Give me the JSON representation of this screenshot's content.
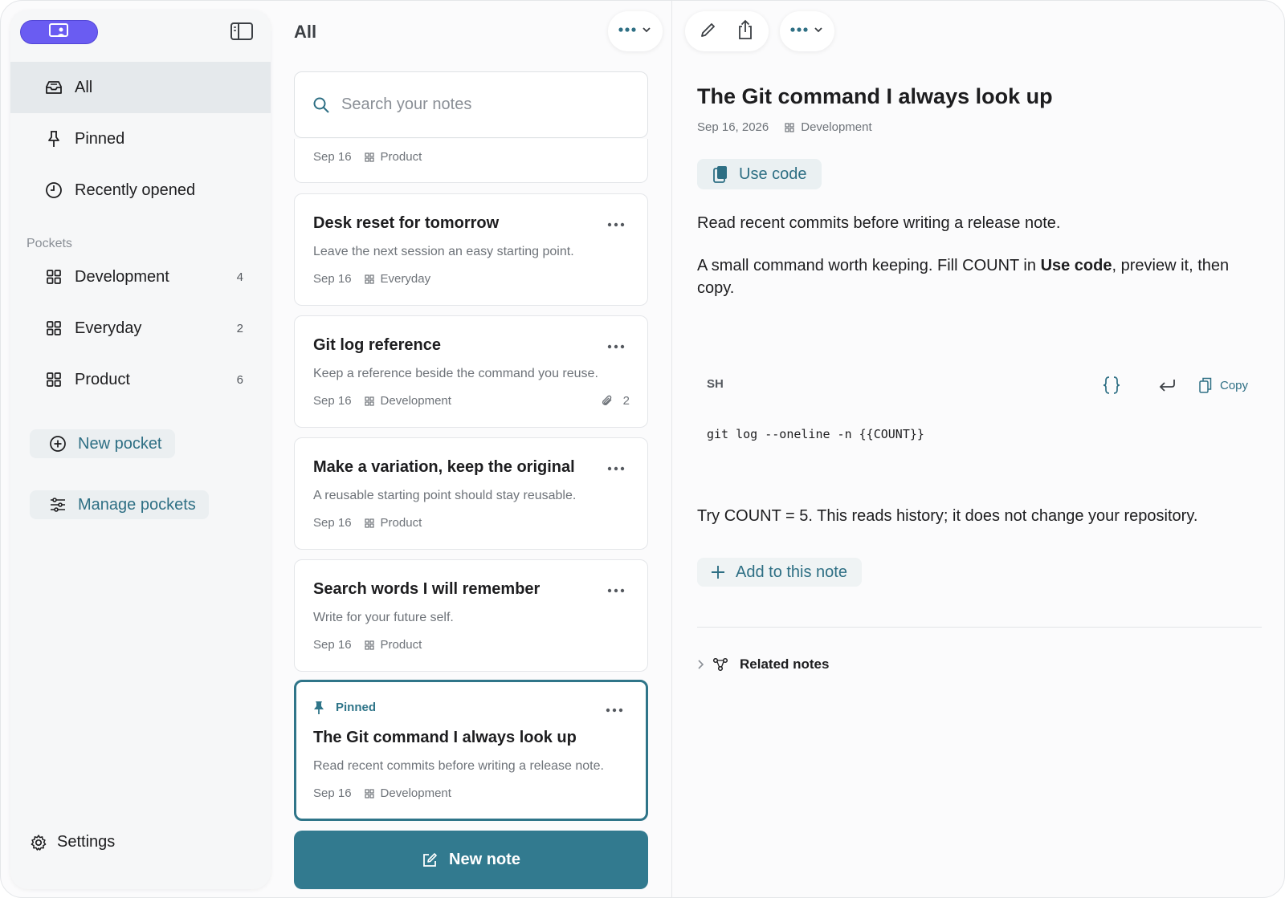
{
  "list": {
    "title": "All",
    "search_placeholder": "Search your notes",
    "partial_card": {
      "date": "Sep 16",
      "pocket": "Product"
    },
    "cards": [
      {
        "title": "Desk reset for tomorrow",
        "desc": "Leave the next session an easy starting point.",
        "date": "Sep 16",
        "pocket": "Everyday"
      },
      {
        "title": "Git log reference",
        "desc": "Keep a reference beside the command you reuse.",
        "date": "Sep 16",
        "pocket": "Development",
        "attachments": "2"
      },
      {
        "title": "Make a variation, keep the original",
        "desc": "A reusable starting point should stay reusable.",
        "date": "Sep 16",
        "pocket": "Product"
      },
      {
        "title": "Search words I will remember",
        "desc": "Write for your future self.",
        "date": "Sep 16",
        "pocket": "Product"
      },
      {
        "pinned_label": "Pinned",
        "title": "The Git command I always look up",
        "desc": "Read recent commits before writing a release note.",
        "date": "Sep 16",
        "pocket": "Development"
      }
    ],
    "new_note_label": "New note"
  },
  "sidebar": {
    "nav": [
      {
        "label": "All",
        "icon": "tray-icon"
      },
      {
        "label": "Pinned",
        "icon": "pin-icon"
      },
      {
        "label": "Recently opened",
        "icon": "clock-icon"
      }
    ],
    "pockets_label": "Pockets",
    "pockets": [
      {
        "label": "Development",
        "count": "4"
      },
      {
        "label": "Everyday",
        "count": "2"
      },
      {
        "label": "Product",
        "count": "6"
      }
    ],
    "new_pocket_label": "New pocket",
    "manage_pockets_label": "Manage pockets",
    "settings_label": "Settings"
  },
  "detail": {
    "title": "The Git command I always look up",
    "date": "Sep 16, 2026",
    "pocket": "Development",
    "use_code_label": "Use code",
    "para1": "Read recent commits before writing a release note.",
    "para2_before": "A small command worth keeping. Fill COUNT in ",
    "para2_bold": "Use code",
    "para2_after": ", preview it, then copy.",
    "code_lang": "SH",
    "code_copy_label": "Copy",
    "code_text": "git log --oneline -n {{COUNT}}",
    "para3": "Try COUNT = 5. This reads history; it does not change your repository.",
    "add_label": "Add to this note",
    "related_label": "Related notes"
  },
  "colors": {
    "accent": "#327a8f",
    "app_pill": "#6a5cf2",
    "active_nav": "#e5e9ec"
  }
}
